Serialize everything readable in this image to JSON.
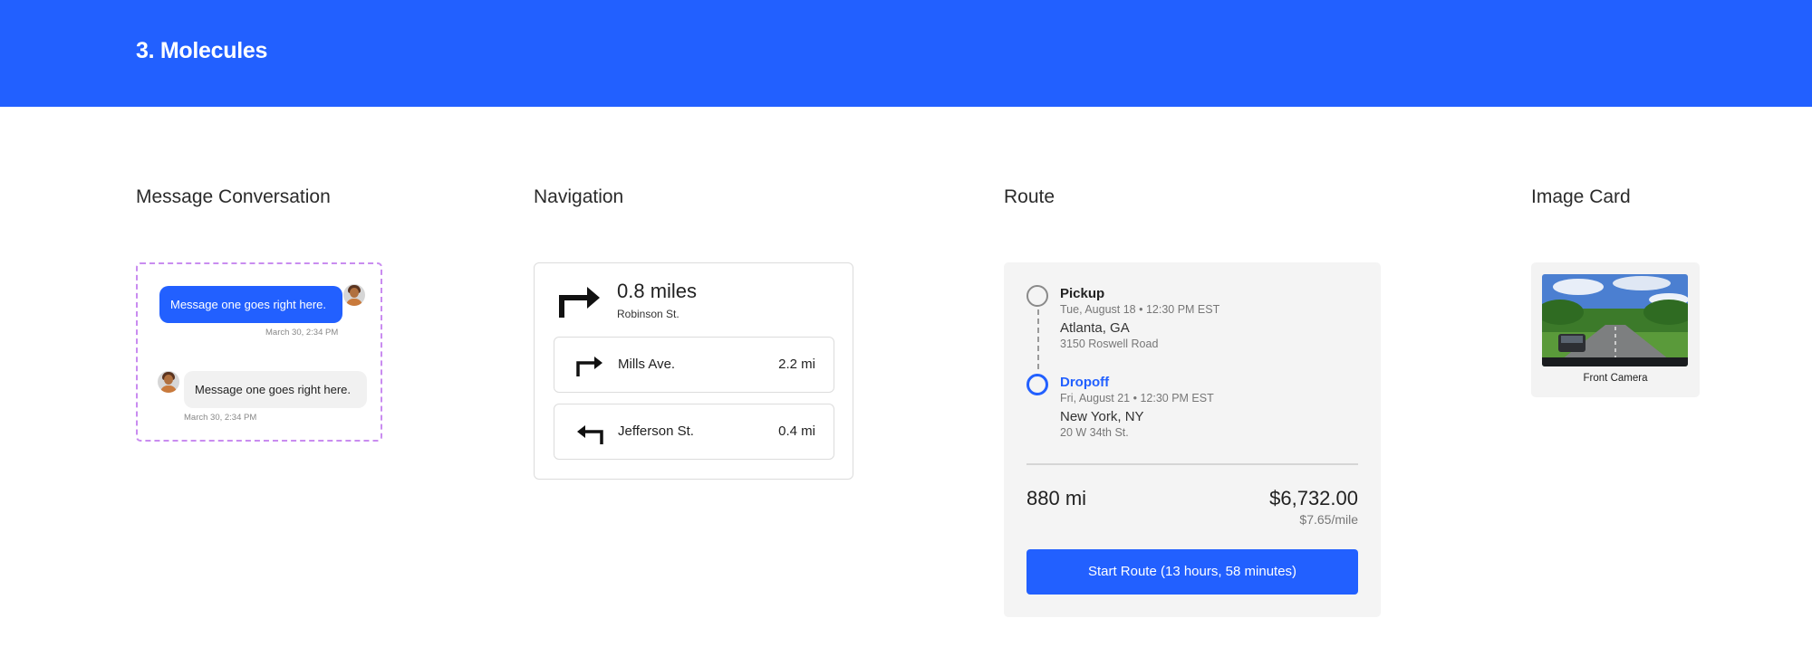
{
  "header": {
    "title": "3. Molecules",
    "color": "#2260ff"
  },
  "sections": {
    "message_conversation": "Message Conversation",
    "navigation": "Navigation",
    "route": "Route",
    "image_card": "Image Card"
  },
  "conversation": {
    "messages": [
      {
        "direction": "outgoing",
        "text": "Message one goes right here.",
        "time": "March 30, 2:34 PM"
      },
      {
        "direction": "incoming",
        "text": "Message one goes right here.",
        "time": "March 30, 2:34 PM"
      }
    ]
  },
  "navigation": {
    "current": {
      "distance": "0.8 miles",
      "street": "Robinson St.",
      "icon": "turn-right-icon"
    },
    "upcoming": [
      {
        "street": "Mills Ave.",
        "distance": "2.2 mi",
        "icon": "turn-right-icon"
      },
      {
        "street": "Jefferson St.",
        "distance": "0.4 mi",
        "icon": "turn-left-icon"
      }
    ]
  },
  "route": {
    "pickup": {
      "label": "Pickup",
      "date": "Tue, August 18 • 12:30 PM EST",
      "city": "Atlanta, GA",
      "street": "3150 Roswell Road"
    },
    "dropoff": {
      "label": "Dropoff",
      "date": "Fri, August 21 • 12:30 PM EST",
      "city": "New York, NY",
      "street": "20 W 34th St."
    },
    "distance": "880 mi",
    "price": "$6,732.00",
    "rate": "$7.65/mile",
    "button_label": "Start Route (13 hours, 58 minutes)",
    "accent_color": "#2260ff"
  },
  "image_card": {
    "caption": "Front Camera"
  }
}
